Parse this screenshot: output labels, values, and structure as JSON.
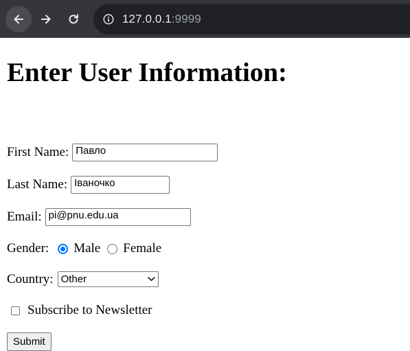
{
  "browser": {
    "url_host": "127.0.0.1",
    "url_port": ":9999",
    "icons": [
      "back-arrow-icon",
      "forward-arrow-icon",
      "reload-icon",
      "info-icon"
    ]
  },
  "page": {
    "heading": "Enter User Information:"
  },
  "form": {
    "first_name": {
      "label": "First Name:",
      "value": "Павло"
    },
    "last_name": {
      "label": "Last Name:",
      "value": "Іваночко"
    },
    "email": {
      "label": "Email:",
      "value": "pi@pnu.edu.ua"
    },
    "gender": {
      "label": "Gender:",
      "option_male": "Male",
      "option_female": "Female",
      "selected": "Male"
    },
    "country": {
      "label": "Country:",
      "selected": "Other"
    },
    "newsletter": {
      "label": "Subscribe to Newsletter",
      "checked": false
    },
    "submit_label": "Submit"
  },
  "colors": {
    "accent": "#0075ff",
    "toolbar": "#35363a",
    "omnibox": "#202124"
  }
}
